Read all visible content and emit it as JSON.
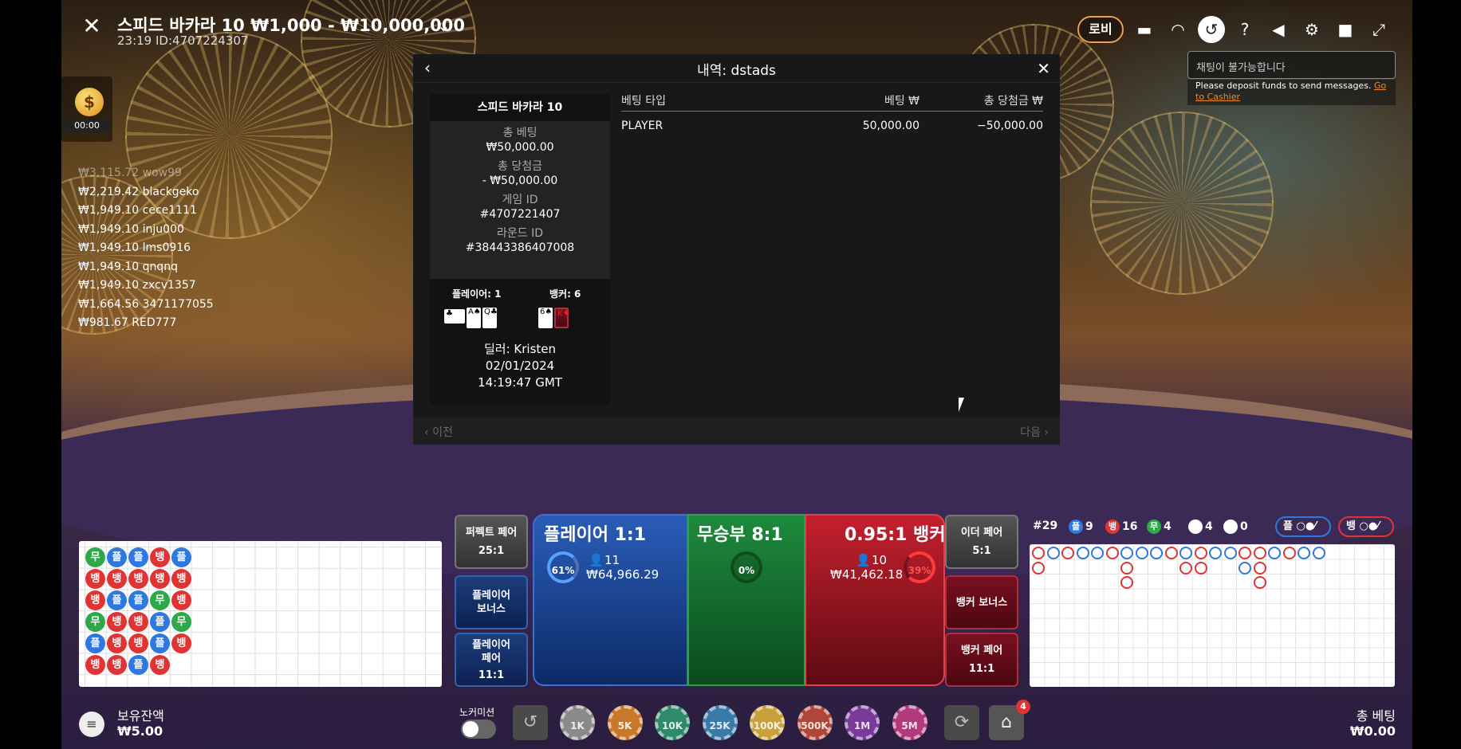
{
  "header": {
    "close_icon": "close-icon",
    "title": "스피드 바카라 10 ₩1,000 - ₩10,000,000",
    "subtitle": "23:19 ID:4707224307",
    "lobby_label": "로비"
  },
  "chat": {
    "placeholder": "채팅이 불가능합니다",
    "note_text": "Please deposit funds to send messages.",
    "note_link": "Go to Cashier"
  },
  "timer": {
    "value": "00:00"
  },
  "winners": [
    "₩3,115.72 wow99",
    "₩2,219.42 blackgeko",
    "₩1,949.10 cece1111",
    "₩1,949.10 inju000",
    "₩1,949.10 lms0916",
    "₩1,949.10 qnqnq",
    "₩1,949.10 zxcv1357",
    "₩1,664.56 3471177055",
    "₩981.67 RED777"
  ],
  "modal": {
    "title": "내역: dstads",
    "game_name": "스피드 바카라 10",
    "total_bet_label": "총 베팅",
    "total_bet": "₩50,000.00",
    "total_win_label": "총 당첨금",
    "total_win": "- ₩50,000.00",
    "game_id_label": "게임 ID",
    "game_id": "#4707221407",
    "round_id_label": "라운드 ID",
    "round_id": "#38443386407008",
    "player_label": "플레이어: 1",
    "banker_label": "뱅커: 6",
    "dealer": "딜러: Kristen",
    "date": "02/01/2024",
    "time": "14:19:47 GMT",
    "col_type": "베팅 타입",
    "col_bet": "베팅 ₩",
    "col_win": "총 당첨금 ₩",
    "row_type": "PLAYER",
    "row_bet": "50,000.00",
    "row_win": "−50,000.00",
    "prev": "이전",
    "next": "다음"
  },
  "bets": {
    "perfect_pair": "퍼펙트 페어",
    "perfect_pair_odds": "25:1",
    "player_bonus": "플레이어 보너스",
    "player_pair": "플레이어 페어",
    "player_pair_odds": "11:1",
    "player_label": "플레이어 1:1",
    "player_pct": "61%",
    "player_count": "11",
    "player_amount": "₩64,966.29",
    "tie_label": "무승부 8:1",
    "tie_pct": "0%",
    "banker_label": "0.95:1 뱅커",
    "banker_pct": "39%",
    "banker_count": "10",
    "banker_amount": "₩41,462.18",
    "either_pair": "이더 페어",
    "either_pair_odds": "5:1",
    "banker_bonus": "뱅커 보너스",
    "banker_pair": "뱅커 페어",
    "banker_pair_odds": "11:1"
  },
  "stats": {
    "round": "#29",
    "player": "9",
    "banker": "16",
    "tie": "4",
    "pp": "4",
    "bp": "0",
    "p_pred": "플",
    "b_pred": "뱅",
    "p_glyph": "플",
    "b_glyph": "뱅",
    "t_glyph": "무"
  },
  "bead_road": [
    [
      "무",
      "뱅",
      "뱅",
      "무",
      "플",
      "뱅"
    ],
    [
      "플",
      "뱅",
      "플",
      "뱅",
      "뱅",
      "뱅"
    ],
    [
      "플",
      "뱅",
      "플",
      "뱅",
      "뱅",
      "플"
    ],
    [
      "뱅",
      "뱅",
      "무",
      "플",
      "플",
      "뱅"
    ],
    [
      "플",
      "뱅",
      "뱅",
      "무",
      "뱅",
      ""
    ]
  ],
  "footer": {
    "balance_label": "보유잔액",
    "balance": "₩5.00",
    "no_commission": "노커미션",
    "chips": [
      "1K",
      "5K",
      "10K",
      "25K",
      "100K",
      "500K",
      "1M",
      "5M"
    ],
    "chip_colors": [
      "#8a8a8a",
      "#c9782a",
      "#2e8a6a",
      "#3a7aa8",
      "#c9a03a",
      "#b0463a",
      "#7a3a9a",
      "#b03a7a"
    ],
    "total_bet_label": "총 베팅",
    "total_bet": "₩0.00",
    "badge": "4"
  }
}
